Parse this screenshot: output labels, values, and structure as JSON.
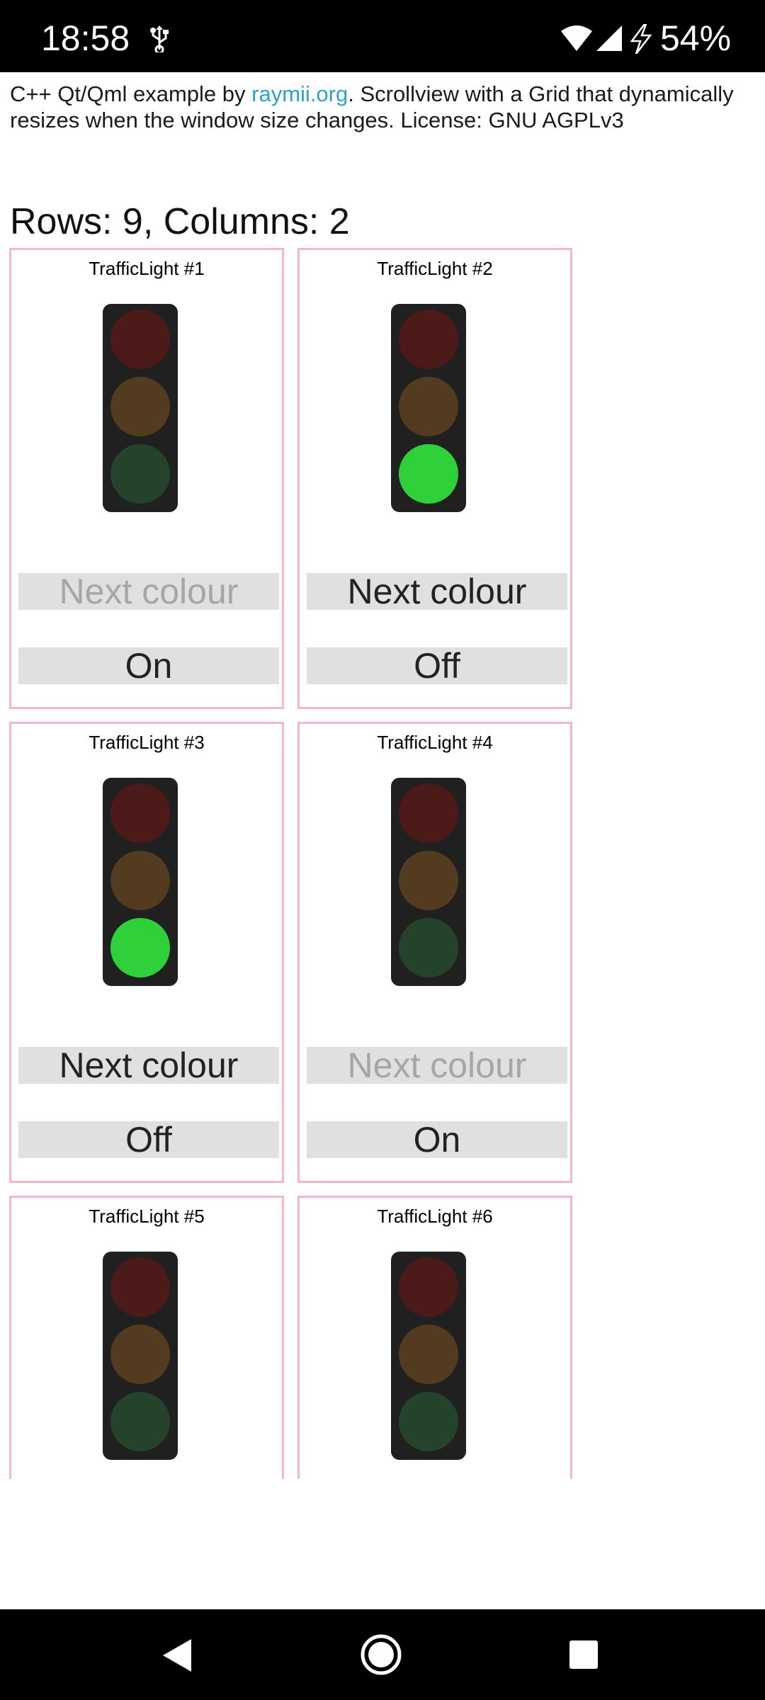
{
  "status_bar": {
    "time": "18:58",
    "battery": "54%",
    "icons": [
      "usb-icon",
      "wifi-icon",
      "signal-icon",
      "charging-bolt-icon"
    ]
  },
  "intro": {
    "prefix": "C++ Qt/Qml example by ",
    "link": "raymii.org",
    "suffix": ". Scrollview with a Grid that dynamically resizes when the window size changes. License: GNU AGPLv3"
  },
  "grid_info": "Rows: 9, Columns: 2",
  "lights": [
    {
      "title": "TrafficLight #1",
      "active_lamp": "none",
      "next_label": "Next colour",
      "next_enabled": false,
      "toggle_label": "On"
    },
    {
      "title": "TrafficLight #2",
      "active_lamp": "green",
      "next_label": "Next colour",
      "next_enabled": true,
      "toggle_label": "Off"
    },
    {
      "title": "TrafficLight #3",
      "active_lamp": "green",
      "next_label": "Next colour",
      "next_enabled": true,
      "toggle_label": "Off"
    },
    {
      "title": "TrafficLight #4",
      "active_lamp": "none",
      "next_label": "Next colour",
      "next_enabled": false,
      "toggle_label": "On"
    },
    {
      "title": "TrafficLight #5",
      "active_lamp": "none"
    },
    {
      "title": "TrafficLight #6",
      "active_lamp": "none"
    }
  ],
  "colors": {
    "link": "#2aa3c4",
    "card_border": "#f2b8c6",
    "lamp_red_off": "#4d1a1a",
    "lamp_yellow_off": "#523b1e",
    "lamp_green_off": "#25422a",
    "lamp_green_on": "#30d03a",
    "button_bg": "#e0e0e0",
    "button_disabled_text": "#a6a6a6"
  },
  "nav_bar": {
    "icons": [
      "back-icon",
      "home-icon",
      "recents-icon"
    ]
  }
}
